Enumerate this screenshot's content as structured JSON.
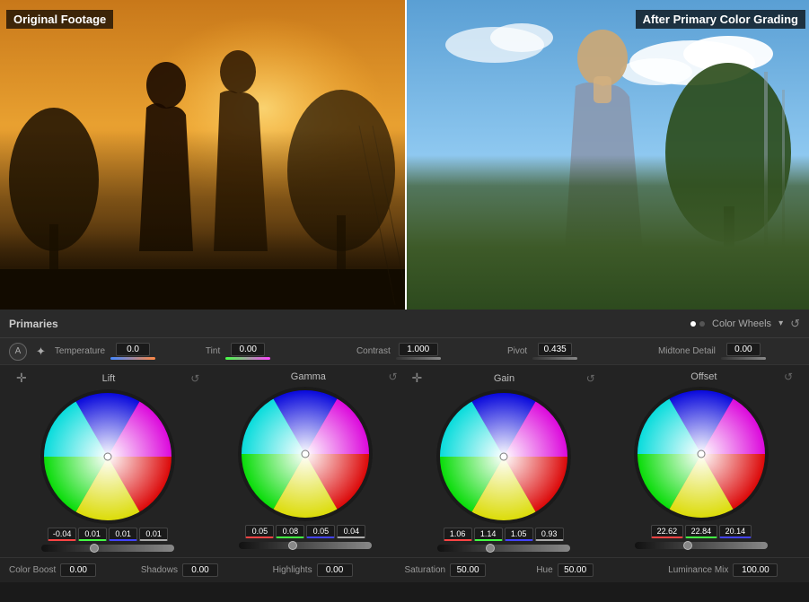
{
  "labels": {
    "original": "Original Footage",
    "graded": "After Primary Color Grading"
  },
  "panel": {
    "title": "Primaries",
    "color_wheels_label": "Color Wheels",
    "auto_label": "A",
    "toolbar": {
      "temperature_label": "Temperature",
      "temperature_value": "0.0",
      "tint_label": "Tint",
      "tint_value": "0.00",
      "contrast_label": "Contrast",
      "contrast_value": "1.000",
      "pivot_label": "Pivot",
      "pivot_value": "0.435",
      "midtone_label": "Midtone Detail",
      "midtone_value": "0.00"
    },
    "wheels": [
      {
        "id": "lift",
        "title": "Lift",
        "dot_x": "50%",
        "dot_y": "50%",
        "values": [
          "-0.04",
          "0.01",
          "0.01",
          "0.01"
        ]
      },
      {
        "id": "gamma",
        "title": "Gamma",
        "dot_x": "50%",
        "dot_y": "50%",
        "values": [
          "0.05",
          "0.08",
          "0.05",
          "0.04"
        ]
      },
      {
        "id": "gain",
        "title": "Gain",
        "dot_x": "50%",
        "dot_y": "50%",
        "values": [
          "1.06",
          "1.14",
          "1.05",
          "0.93"
        ]
      },
      {
        "id": "offset",
        "title": "Offset",
        "dot_x": "50%",
        "dot_y": "50%",
        "values": [
          "22.62",
          "22.84",
          "20.14",
          ""
        ]
      }
    ],
    "bottom": {
      "color_boost_label": "Color Boost",
      "color_boost_value": "0.00",
      "shadows_label": "Shadows",
      "shadows_value": "0.00",
      "highlights_label": "Highlights",
      "highlights_value": "0.00",
      "saturation_label": "Saturation",
      "saturation_value": "50.00",
      "hue_label": "Hue",
      "hue_value": "50.00",
      "luminance_mix_label": "Luminance Mix",
      "luminance_mix_value": "100.00"
    }
  }
}
